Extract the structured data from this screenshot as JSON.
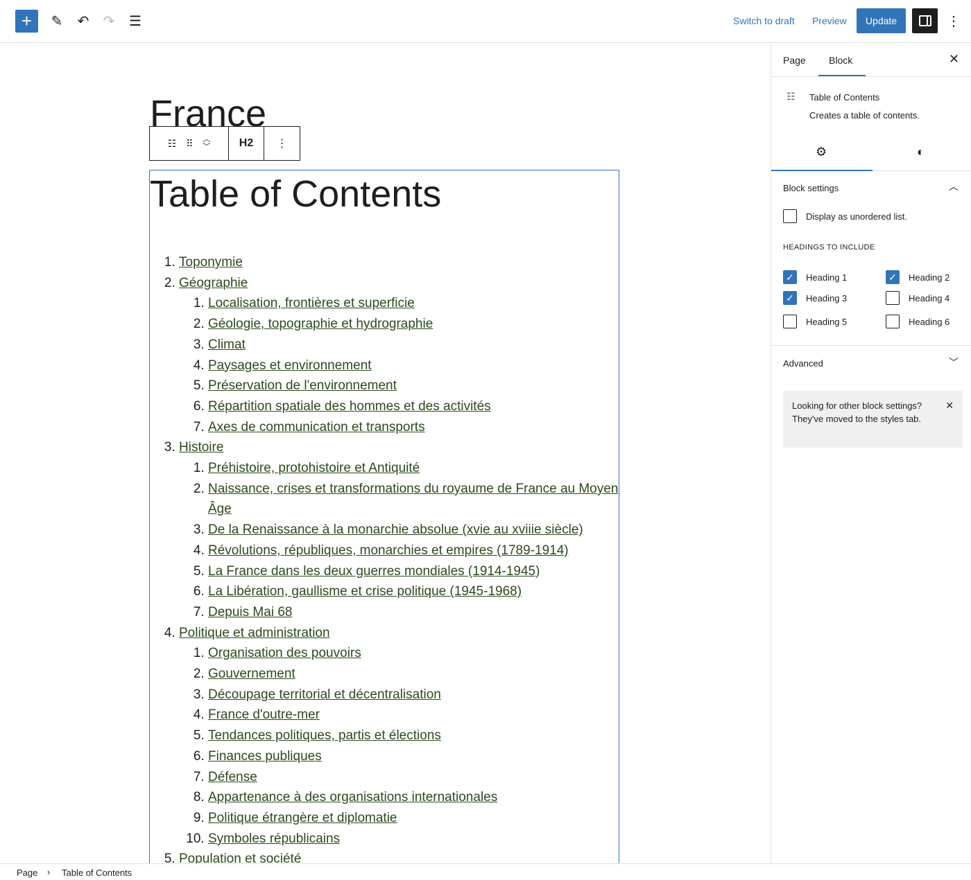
{
  "header": {
    "switch_to_draft": "Switch to draft",
    "preview": "Preview",
    "update": "Update",
    "h2_label": "H2"
  },
  "page": {
    "title": "France"
  },
  "toc": {
    "title": "Table of Contents",
    "items": [
      {
        "label": "Toponymie",
        "children": []
      },
      {
        "label": "Géographie",
        "children": [
          "Localisation, frontières et superficie",
          "Géologie, topographie et hydrographie",
          "Climat",
          "Paysages et environnement",
          "Préservation de l'environnement",
          "Répartition spatiale des hommes et des activités",
          "Axes de communication et transports"
        ]
      },
      {
        "label": "Histoire",
        "children": [
          "Préhistoire, protohistoire et Antiquité",
          "Naissance, crises et transformations du royaume de France au Moyen Âge",
          "De la Renaissance à la monarchie absolue (xvie au xviiie siècle)",
          "Révolutions, républiques, monarchies et empires (1789-1914)",
          "La France dans les deux guerres mondiales (1914-1945)",
          "La Libération, gaullisme et crise politique (1945-1968)",
          "Depuis Mai 68"
        ]
      },
      {
        "label": "Politique et administration",
        "children": [
          "Organisation des pouvoirs",
          "Gouvernement",
          "Découpage territorial et décentralisation",
          "France d'outre-mer",
          "Tendances politiques, partis et élections",
          "Finances publiques",
          "Défense",
          "Appartenance à des organisations internationales",
          "Politique étrangère et diplomatie",
          "Symboles républicains"
        ]
      },
      {
        "label": "Population et société",
        "children": []
      }
    ]
  },
  "sidebar": {
    "tabs": [
      "Page",
      "Block"
    ],
    "active_tab": "Block",
    "block_name": "Table of Contents",
    "block_desc": "Creates a table of contents.",
    "block_settings": "Block settings",
    "unordered_label": "Display as unordered list.",
    "unordered_checked": false,
    "headings_label": "HEADINGS TO INCLUDE",
    "headings": [
      {
        "label": "Heading 1",
        "checked": true
      },
      {
        "label": "Heading 2",
        "checked": true
      },
      {
        "label": "Heading 3",
        "checked": true
      },
      {
        "label": "Heading 4",
        "checked": false
      },
      {
        "label": "Heading 5",
        "checked": false
      },
      {
        "label": "Heading 6",
        "checked": false
      }
    ],
    "advanced": "Advanced",
    "notice": "Looking for other block settings? They've moved to the styles tab."
  },
  "breadcrumb": [
    "Page",
    "Table of Contents"
  ],
  "colors": {
    "accent": "#3174b8",
    "link": "#2b4a1c"
  }
}
